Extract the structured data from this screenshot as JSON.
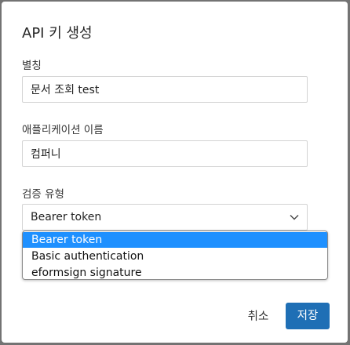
{
  "dialog": {
    "title": "API 키 생성",
    "alias": {
      "label": "별칭",
      "value": "문서 조회 test"
    },
    "application_name": {
      "label": "애플리케이션 이름",
      "value": "컴퍼니"
    },
    "auth_type": {
      "label": "검증 유형",
      "selected": "Bearer token",
      "options": [
        "Bearer token",
        "Basic authentication",
        "eformsign signature"
      ]
    },
    "buttons": {
      "cancel": "취소",
      "save": "저장"
    }
  },
  "colors": {
    "primary": "#1f6fb5",
    "option_highlight": "#1e90ff",
    "overlay": "#737373"
  },
  "icons": {
    "select_arrow": "chevron-down-icon"
  }
}
